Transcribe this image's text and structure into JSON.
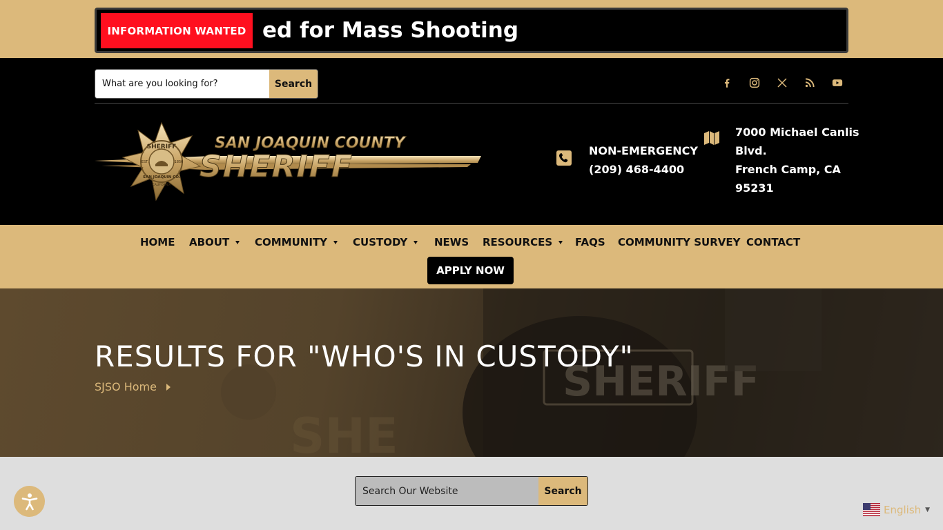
{
  "ticker": {
    "label": "INFORMATION WANTED",
    "text": "ed for Mass Shooting"
  },
  "header": {
    "search": {
      "placeholder": "What are you looking for?",
      "button": "Search"
    },
    "social_icons": [
      "facebook-icon",
      "instagram-icon",
      "x-icon",
      "rss-icon",
      "youtube-icon"
    ],
    "logo": {
      "line1": "SAN JOAQUIN COUNTY",
      "line2": "SHERIFF",
      "badge_top": "SHERIFF",
      "badge_mid": "SAN JOAQUIN CO.",
      "badge_bottom": "CALIFORNIA",
      "badge_est": "EST.",
      "badge_year": "1850"
    },
    "phone": {
      "label": "NON-EMERGENCY",
      "number": "(209) 468-4400"
    },
    "address": {
      "line1": "7000 Michael Canlis",
      "line2": "Blvd.",
      "line3": "French Camp, CA",
      "line4": "95231"
    }
  },
  "nav": {
    "items": [
      {
        "label": "HOME",
        "dropdown": false
      },
      {
        "label": "ABOUT",
        "dropdown": true
      },
      {
        "label": "COMMUNITY",
        "dropdown": true
      },
      {
        "label": "CUSTODY",
        "dropdown": true
      },
      {
        "label": "NEWS",
        "dropdown": false
      },
      {
        "label": "RESOURCES",
        "dropdown": true
      },
      {
        "label": "FAQS",
        "dropdown": false
      },
      {
        "label": "COMMUNITY SURVEY",
        "dropdown": false
      },
      {
        "label": "CONTACT",
        "dropdown": false
      }
    ],
    "apply_button": "APPLY NOW"
  },
  "hero": {
    "title": "RESULTS FOR \"WHO'S IN CUSTODY\"",
    "breadcrumb": "SJSO Home"
  },
  "search_section": {
    "placeholder": "Search Our Website",
    "button": "Search"
  },
  "language": {
    "label": "English"
  },
  "colors": {
    "gold": "#dcb97b",
    "black": "#000000",
    "alert_red": "#ff0f1f",
    "page_gray": "#dedede"
  }
}
